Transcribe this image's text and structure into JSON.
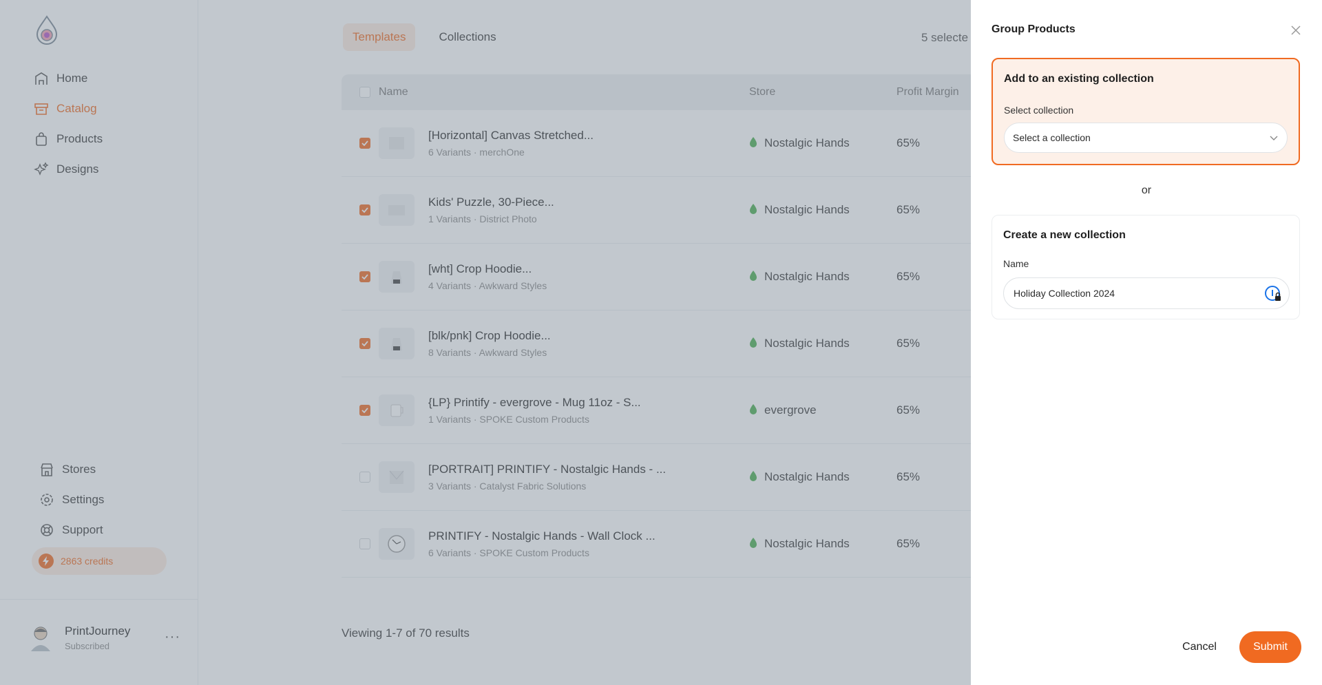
{
  "sidebar": {
    "nav": [
      {
        "label": "Home",
        "icon": "home-icon"
      },
      {
        "label": "Catalog",
        "icon": "catalog-icon"
      },
      {
        "label": "Products",
        "icon": "bag-icon"
      },
      {
        "label": "Designs",
        "icon": "sparkle-icon"
      }
    ],
    "bottom_nav": [
      {
        "label": "Stores",
        "icon": "store-icon"
      },
      {
        "label": "Settings",
        "icon": "gear-icon"
      },
      {
        "label": "Support",
        "icon": "lifebuoy-icon"
      }
    ],
    "credits": "2863 credits",
    "user": {
      "name": "PrintJourney",
      "status": "Subscribed",
      "more": "···"
    }
  },
  "main": {
    "tabs": [
      {
        "label": "Templates"
      },
      {
        "label": "Collections"
      }
    ],
    "selected_count": "5 selecte",
    "columns": {
      "name": "Name",
      "store": "Store",
      "margin": "Profit Margin"
    },
    "rows": [
      {
        "name": "[Horizontal] Canvas Stretched...",
        "meta": "6 Variants · merchOne",
        "store": "Nostalgic Hands",
        "margin": "65%",
        "checked": true
      },
      {
        "name": "Kids' Puzzle, 30-Piece...",
        "meta": "1 Variants · District Photo",
        "store": "Nostalgic Hands",
        "margin": "65%",
        "checked": true
      },
      {
        "name": "[wht] Crop Hoodie...",
        "meta": "4 Variants · Awkward Styles",
        "store": "Nostalgic Hands",
        "margin": "65%",
        "checked": true
      },
      {
        "name": "[blk/pnk] Crop Hoodie...",
        "meta": "8 Variants · Awkward Styles",
        "store": "Nostalgic Hands",
        "margin": "65%",
        "checked": true
      },
      {
        "name": "{LP} Printify - evergrove - Mug 11oz - S...",
        "meta": "1 Variants · SPOKE Custom Products",
        "store": "evergrove",
        "margin": "65%",
        "checked": true
      },
      {
        "name": "[PORTRAIT] PRINTIFY - Nostalgic Hands - ...",
        "meta": "3 Variants · Catalyst Fabric Solutions",
        "store": "Nostalgic Hands",
        "margin": "65%",
        "checked": false
      },
      {
        "name": "PRINTIFY - Nostalgic Hands - Wall Clock ...",
        "meta": "6 Variants · SPOKE Custom Products",
        "store": "Nostalgic Hands",
        "margin": "65%",
        "checked": false
      }
    ],
    "results": "Viewing 1-7 of 70 results"
  },
  "panel": {
    "title": "Group Products",
    "existing": {
      "title": "Add to an existing collection",
      "label": "Select collection",
      "placeholder": "Select a collection"
    },
    "or": "or",
    "new": {
      "title": "Create a new collection",
      "label": "Name",
      "value": "Holiday Collection 2024"
    },
    "cancel": "Cancel",
    "submit": "Submit"
  },
  "colors": {
    "accent": "#f06a21",
    "overlay": "#788692"
  }
}
